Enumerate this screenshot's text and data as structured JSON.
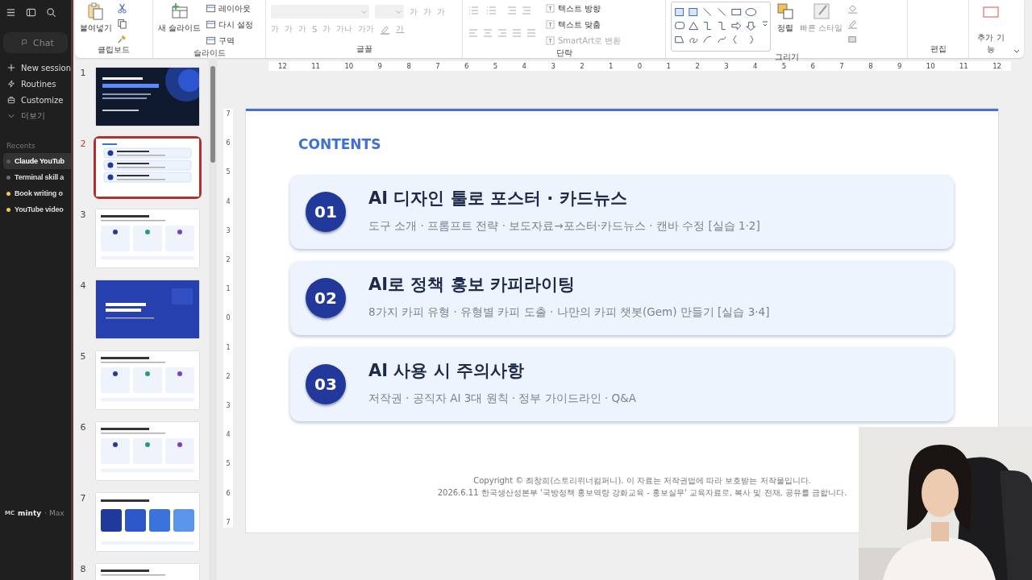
{
  "sidebar": {
    "chat_placeholder": "Chat",
    "nav": [
      {
        "label": "New session"
      },
      {
        "label": "Routines"
      },
      {
        "label": "Customize"
      },
      {
        "label": "더보기"
      }
    ],
    "recents_label": "Recents",
    "recents": [
      {
        "label": "Claude YouTub",
        "selected": true,
        "color": "#5c5c5c"
      },
      {
        "label": "Terminal skill a",
        "selected": false,
        "color": "#6e6e6e"
      },
      {
        "label": "Book writing o",
        "selected": false,
        "color": "#f2c94c"
      },
      {
        "label": "YouTube video",
        "selected": false,
        "color": "#f2c94c"
      }
    ],
    "user": {
      "initials": "MC",
      "name": "minty",
      "plan": "· Max"
    }
  },
  "ribbon": {
    "clipboard": {
      "label": "클립보드",
      "paste": "붙여넣기"
    },
    "slides": {
      "label": "슬라이드",
      "new_slide": "새 슬라이드",
      "small": [
        "레이아웃",
        "다시 설정",
        "구역"
      ]
    },
    "font": {
      "label": "글꼴",
      "disabled": true,
      "top_glyphs": [
        "가",
        "가",
        "가"
      ],
      "bottom_glyphs": [
        "가",
        "가",
        "가",
        "S",
        "가",
        "가나",
        "가가"
      ],
      "color_glyph": "가"
    },
    "paragraph": {
      "label": "단락",
      "small": [
        {
          "label": "텍스트 방향",
          "disabled": false
        },
        {
          "label": "텍스트 맞춤",
          "disabled": false
        },
        {
          "label": "SmartArt로 변환",
          "disabled": true
        }
      ]
    },
    "drawing": {
      "label": "그리기",
      "arrange": "정렬",
      "quick_styles": "빠른 스타일"
    },
    "editing": {
      "label": "편집"
    },
    "addins": {
      "label": "추가 기능"
    }
  },
  "ruler": {
    "horizontal": [
      "12",
      "11",
      "10",
      "9",
      "8",
      "7",
      "6",
      "5",
      "4",
      "3",
      "2",
      "1",
      "0",
      "1",
      "2",
      "3",
      "4",
      "5",
      "6",
      "7",
      "8",
      "9",
      "10",
      "11",
      "12"
    ],
    "vertical": [
      "7",
      "6",
      "5",
      "4",
      "3",
      "2",
      "1",
      "0",
      "1",
      "2",
      "3",
      "4",
      "5",
      "6",
      "7"
    ]
  },
  "thumbnails": [
    {
      "number": "1",
      "selected": false,
      "kind": "dark"
    },
    {
      "number": "2",
      "selected": true,
      "kind": "contents"
    },
    {
      "number": "3",
      "selected": false,
      "kind": "cards"
    },
    {
      "number": "4",
      "selected": false,
      "kind": "blue"
    },
    {
      "number": "5",
      "selected": false,
      "kind": "cards"
    },
    {
      "number": "6",
      "selected": false,
      "kind": "cards"
    },
    {
      "number": "7",
      "selected": false,
      "kind": "tiles"
    },
    {
      "number": "8",
      "selected": false,
      "kind": "cards"
    }
  ],
  "slide": {
    "heading": "CONTENTS",
    "items": [
      {
        "number": "01",
        "title": "AI 디자인 툴로 포스터 · 카드뉴스",
        "subtitle": "도구 소개 · 프롬프트 전략 · 보도자료→포스터·카드뉴스 · 캔바 수정 [실습 1·2]"
      },
      {
        "number": "02",
        "title": "AI로 정책 홍보 카피라이팅",
        "subtitle": "8가지 카피 유형 · 유형별 카피 도출 · 나만의 카피 챗봇(Gem) 만들기 [실습 3·4]"
      },
      {
        "number": "03",
        "title": "AI 사용 시 주의사항",
        "subtitle": "저작권 · 공직자 AI 3대 원칙 · 정부 가이드라인 · Q&A"
      }
    ],
    "footer": [
      "Copyright © 최창희(스토리위너컴퍼니). 이 자료는 저작권법에 따라 보호받는 저작물입니다.",
      "2026.6.11 한국생산성본부 '국방정책 홍보역량 강화교육 - 홍보실무' 교육자료로, 복사 및 전재, 공유를 금합니다."
    ]
  }
}
